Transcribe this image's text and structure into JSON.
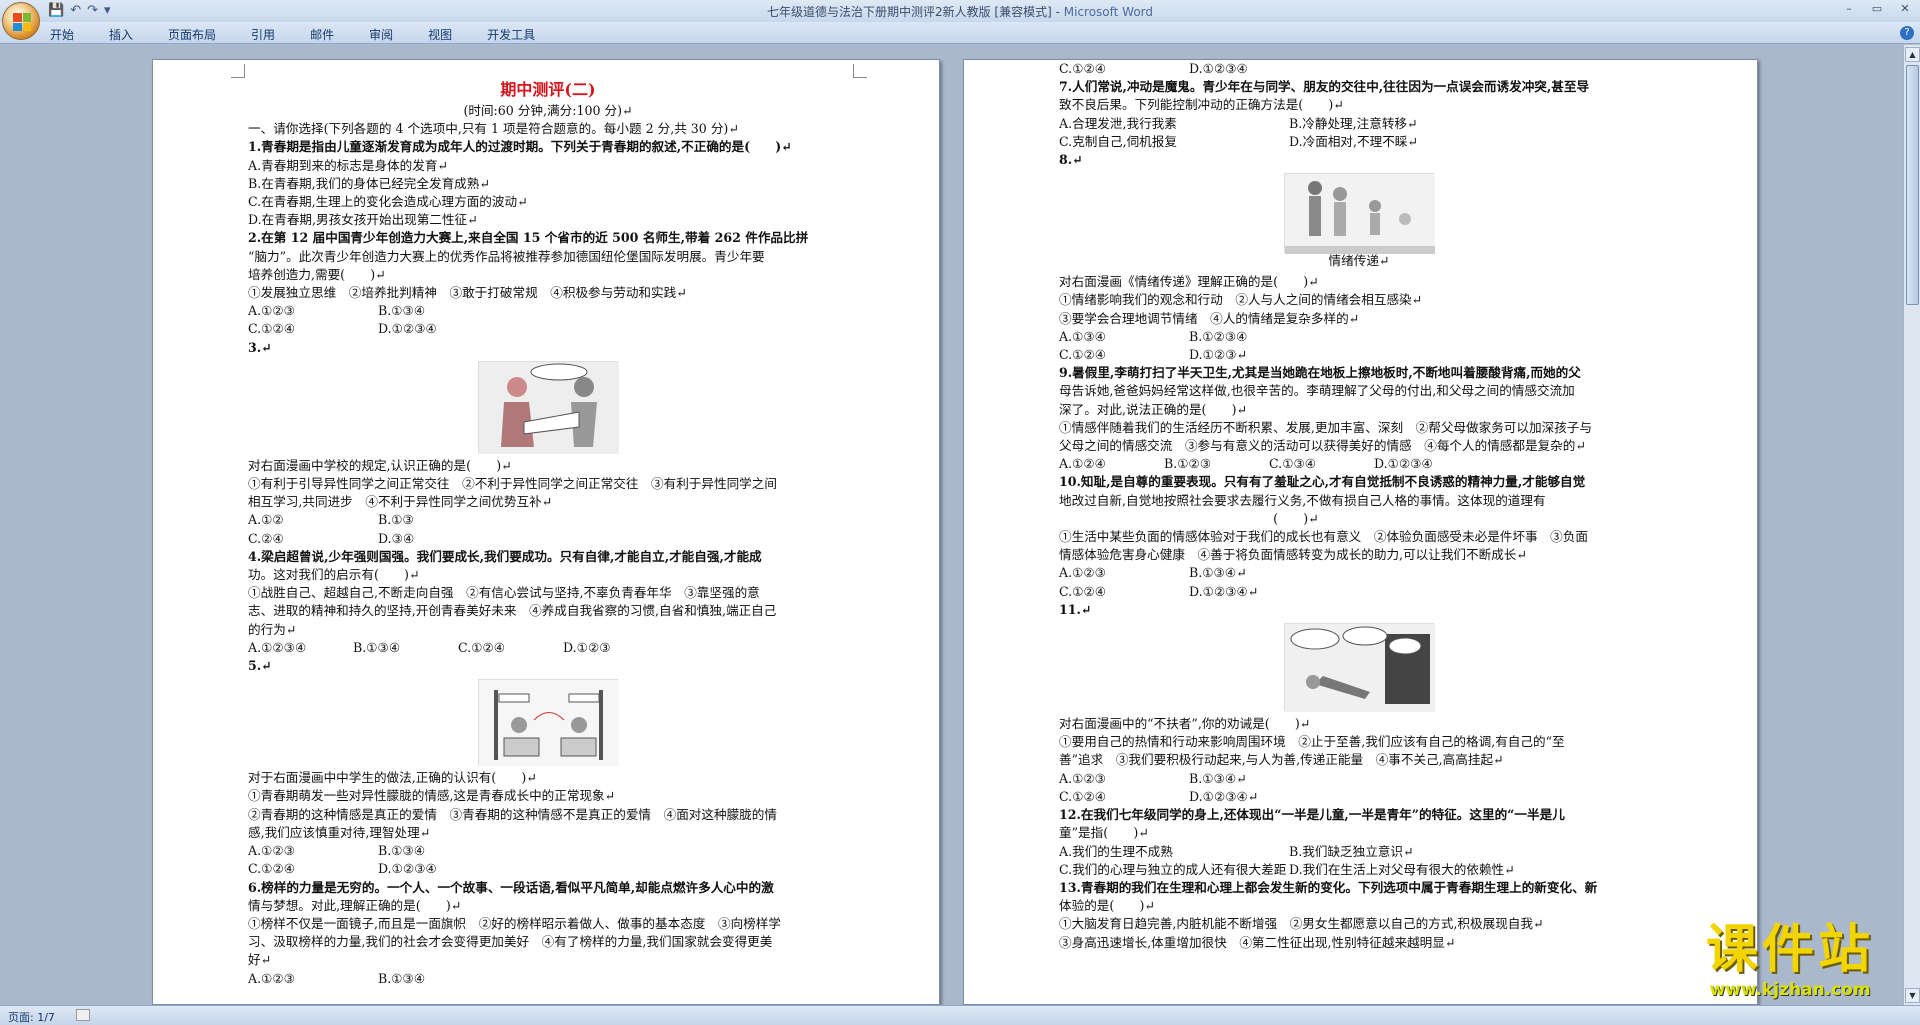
{
  "window": {
    "title": "七年级道德与法治下册期中测评2新人教版 [兼容模式] - Microsoft Word",
    "title_doc": "七年级道德与法治下册期中测评2新人教版 [兼容模式] - ",
    "title_app": "Microsoft Word",
    "controls": [
      "–",
      "▭",
      "✕"
    ]
  },
  "ribbon": {
    "tabs": [
      "开始",
      "插入",
      "页面布局",
      "引用",
      "邮件",
      "审阅",
      "视图",
      "开发工具"
    ],
    "help": "?"
  },
  "quick_access": [
    "save-icon",
    "undo-icon",
    "redo-icon"
  ],
  "status": {
    "page": "页面: 1/7"
  },
  "watermark": {
    "text": "课件站",
    "url": "www.kjzhan.com"
  },
  "page1": {
    "lines": [
      {
        "t": "期中测评(二)",
        "c": "ttl"
      },
      {
        "t": "(时间:60 分钟,满分:100 分)↵",
        "c": "sub"
      },
      {
        "t": "一、请你选择(下列各题的 4 个选项中,只有 1 项是符合题意的。每小题 2 分,共 30 分)↵"
      },
      {
        "t": "1.青春期是指由儿童逐渐发育成为成年人的过渡时期。下列关于青春期的叙述,不正确的是(　　)↵",
        "c": "b"
      },
      {
        "t": "A.青春期到来的标志是身体的发育↵"
      },
      {
        "t": "B.在青春期,我们的身体已经完全发育成熟↵"
      },
      {
        "t": "C.在青春期,生理上的变化会造成心理方面的波动↵"
      },
      {
        "t": "D.在青春期,男孩女孩开始出现第二性征↵"
      },
      {
        "t": "2.在第 12 届中国青少年创造力大赛上,来自全国 15 个省市的近 500 名师生,带着 262 件作品比拼",
        "c": "b"
      },
      {
        "t": "“脑力”。此次青少年创造力大赛上的优秀作品将被推荐参加德国纽伦堡国际发明展。青少年要"
      },
      {
        "t": "培养创造力,需要(　　)↵"
      },
      {
        "t": "①发展独立思维　②培养批判精神　③敢于打破常规　④积极参与劳动和实践↵"
      },
      {
        "o": [
          "A.①②③",
          "B.①③④"
        ]
      },
      {
        "o": [
          "C.①②④",
          "D.①②③④"
        ]
      },
      {
        "t": "3.↵",
        "c": "b"
      },
      {
        "fig": "cartoon-couple",
        "h": 92,
        "w": 140
      },
      {
        "t": "对右面漫画中学校的规定,认识正确的是(　　)↵"
      },
      {
        "t": "①有利于引导异性同学之间正常交往　②不利于异性同学之间正常交往　③有利于异性同学之间"
      },
      {
        "t": "相互学习,共同进步　④不利于异性同学之间优势互补↵"
      },
      {
        "o": [
          "A.①②",
          "B.①③"
        ]
      },
      {
        "o": [
          "C.②④",
          "D.③④"
        ]
      },
      {
        "t": "4.梁启超曾说,少年强则国强。我们要成长,我们要成功。只有自律,才能自立,才能自强,才能成",
        "c": "b"
      },
      {
        "t": "功。这对我们的启示有(　　)↵"
      },
      {
        "t": "①战胜自己、超越自己,不断走向自强　②有信心尝试与坚持,不辜负青春年华　③靠坚强的意"
      },
      {
        "t": "志、进取的精神和持久的坚持,开创青春美好未来　④养成自我省察的习惯,自省和慎独,端正自己"
      },
      {
        "t": "的行为↵"
      },
      {
        "o4": [
          "A.①②③④",
          "B.①③④",
          "C.①②④",
          "D.①②③"
        ]
      },
      {
        "t": "5.↵",
        "c": "b"
      },
      {
        "fig": "cartoon-desks",
        "h": 86,
        "w": 140
      },
      {
        "t": "对于右面漫画中中学生的做法,正确的认识有(　　)↵"
      },
      {
        "t": "①青春期萌发一些对异性朦胧的情感,这是青春成长中的正常现象↵"
      },
      {
        "t": "②青春期的这种情感是真正的爱情　③青春期的这种情感不是真正的爱情　④面对这种朦胧的情"
      },
      {
        "t": "感,我们应该慎重对待,理智处理↵"
      },
      {
        "o": [
          "A.①②③",
          "B.①③④"
        ]
      },
      {
        "o": [
          "C.①②④",
          "D.①②③④"
        ]
      },
      {
        "t": "6.榜样的力量是无穷的。一个人、一个故事、一段话语,看似平凡简单,却能点燃许多人心中的激",
        "c": "b"
      },
      {
        "t": "情与梦想。对此,理解正确的是(　　)↵"
      },
      {
        "t": "①榜样不仅是一面镜子,而且是一面旗帜　②好的榜样昭示着做人、做事的基本态度　③向榜样学"
      },
      {
        "t": "习、汲取榜样的力量,我们的社会才会变得更加美好　④有了榜样的力量,我们国家就会变得更美"
      },
      {
        "t": "好↵"
      },
      {
        "o": [
          "A.①②③",
          "B.①③④"
        ]
      }
    ]
  },
  "page2": {
    "lines": [
      {
        "o": [
          "C.①②④",
          "D.①②③④"
        ]
      },
      {
        "t": "7.人们常说,冲动是魔鬼。青少年在与同学、朋友的交往中,往往因为一点误会而诱发冲突,甚至导",
        "c": "b"
      },
      {
        "t": "致不良后果。下列能控制冲动的正确方法是(　　)↵"
      },
      {
        "ow": [
          "A.合理发泄,我行我素",
          "B.冷静处理,注意转移↵"
        ]
      },
      {
        "ow": [
          "C.克制自己,伺机报复",
          "D.冷面相对,不理不睬↵"
        ]
      },
      {
        "t": "8.↵",
        "c": "b"
      },
      {
        "fig": "cartoon-family",
        "h": 80,
        "w": 150,
        "cap": "情绪传递↵"
      },
      {
        "t": " "
      },
      {
        "t": "对右面漫画《情绪传递》理解正确的是(　　)↵"
      },
      {
        "t": "①情绪影响我们的观念和行动　②人与人之间的情绪会相互感染↵"
      },
      {
        "t": "③要学会合理地调节情绪　④人的情绪是复杂多样的↵"
      },
      {
        "o": [
          "A.①③④",
          "B.①②③④"
        ]
      },
      {
        "o": [
          "C.①②④",
          "D.①②③↵"
        ]
      },
      {
        "t": "9.暑假里,李萌打扫了半天卫生,尤其是当她跪在地板上擦地板时,不断地叫着腰酸背痛,而她的父",
        "c": "b"
      },
      {
        "t": "母告诉她,爸爸妈妈经常这样做,也很辛苦的。李萌理解了父母的付出,和父母之间的情感交流加"
      },
      {
        "t": "深了。对此,说法正确的是(　　)↵"
      },
      {
        "t": "①情感伴随着我们的生活经历不断积累、发展,更加丰富、深刻　②帮父母做家务可以加深孩子与"
      },
      {
        "t": "父母之间的情感交流　③参与有意义的活动可以获得美好的情感　④每个人的情感都是复杂的↵"
      },
      {
        "o4": [
          "A.①②④",
          "B.①②③",
          "C.①③④",
          "D.①②③④"
        ]
      },
      {
        "t": "10.知耻,是自尊的重要表现。只有有了羞耻之心,才有自觉抵制不良诱惑的精神力量,才能够自觉",
        "c": "b"
      },
      {
        "t": "地改过自新,自觉地按照社会要求去履行义务,不做有损自己人格的事情。这体现的道理有"
      },
      {
        "t": "　　　　　　　　　　　　　　　　　(　　)↵"
      },
      {
        "t": "①生活中某些负面的情感体验对于我们的成长也有意义　②体验负面感受未必是件坏事　③负面"
      },
      {
        "t": "情感体验危害身心健康　④善于将负面情感转变为成长的助力,可以让我们不断成长↵"
      },
      {
        "o": [
          "A.①②③",
          "B.①③④↵"
        ]
      },
      {
        "o": [
          "C.①②④",
          "D.①②③④↵"
        ]
      },
      {
        "t": "11.↵",
        "c": "b"
      },
      {
        "fig": "cartoon-fall",
        "h": 88,
        "w": 150
      },
      {
        "t": "对右面漫画中的“不扶者”,你的劝诫是(　　)↵"
      },
      {
        "t": "①要用自己的热情和行动来影响周围环境　②止于至善,我们应该有自己的格调,有自己的“至"
      },
      {
        "t": "善”追求　③我们要积极行动起来,与人为善,传递正能量　④事不关己,高高挂起↵"
      },
      {
        "o": [
          "A.①②③",
          "B.①③④↵"
        ]
      },
      {
        "o": [
          "C.①②④",
          "D.①②③④↵"
        ]
      },
      {
        "t": "12.在我们七年级同学的身上,还体现出“一半是儿童,一半是青年”的特征。这里的“一半是儿",
        "c": "b"
      },
      {
        "t": "童”是指(　　)↵"
      },
      {
        "ow": [
          "A.我们的生理不成熟",
          "B.我们缺乏独立意识↵"
        ]
      },
      {
        "ow": [
          "C.我们的心理与独立的成人还有很大差距",
          "D.我们在生活上对父母有很大的依赖性↵"
        ]
      },
      {
        "t": "13.青春期的我们在生理和心理上都会发生新的变化。下列选项中属于青春期生理上的新变化、新",
        "c": "b"
      },
      {
        "t": "体验的是(　　)↵"
      },
      {
        "t": "①大脑发育日趋完善,内脏机能不断增强　②男女生都愿意以自己的方式,积极展现自我↵"
      },
      {
        "t": "③身高迅速增长,体重增加很快　④第二性征出现,性别特征越来越明显↵"
      }
    ]
  }
}
